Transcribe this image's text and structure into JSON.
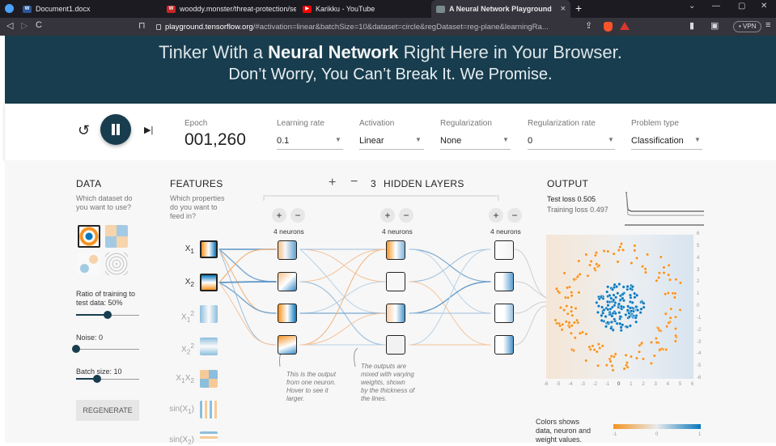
{
  "browser": {
    "tabs": [
      {
        "title": "Document1.docx",
        "icon": "word-icon",
        "color": "#2b579a"
      },
      {
        "title": "wooddy.monster/threat-protection/se",
        "icon": "site-icon",
        "color": "#c62828"
      },
      {
        "title": "Karikku - YouTube",
        "icon": "youtube-icon",
        "color": "#ff0000"
      },
      {
        "title": "A Neural Network Playground",
        "icon": "tensorflow-icon",
        "color": "#7a8a8f"
      }
    ],
    "url_host": "playground.tensorflow.org",
    "url_path": "/#activation=linear&batchSize=10&dataset=circle&regDataset=reg-plane&learningRa...",
    "vpn": "• VPN"
  },
  "hero": {
    "title_pre": "Tinker With a ",
    "title_bold": "Neural Network",
    "title_post": " Right Here in Your Browser.",
    "subtitle": "Don’t Worry, You Can’t Break It. We Promise."
  },
  "controls": {
    "epoch_label": "Epoch",
    "epoch_value": "001,260",
    "learning_rate_label": "Learning rate",
    "learning_rate_value": "0.1",
    "activation_label": "Activation",
    "activation_value": "Linear",
    "regularization_label": "Regularization",
    "regularization_value": "None",
    "reg_rate_label": "Regularization rate",
    "reg_rate_value": "0",
    "problem_type_label": "Problem type",
    "problem_type_value": "Classification"
  },
  "data_panel": {
    "title": "DATA",
    "desc": [
      "Which dataset do",
      "you want to use?"
    ],
    "ratio_label": [
      "Ratio of training to",
      "test data:  50%"
    ],
    "ratio_value": 0.5,
    "noise_label": "Noise:  0",
    "noise_value": 0,
    "batch_label": "Batch size:  10",
    "batch_value": 0.33,
    "regenerate": "REGENERATE"
  },
  "features": {
    "title": "FEATURES",
    "desc": [
      "Which properties",
      "do you want to",
      "feed in?"
    ],
    "items": [
      {
        "base": "X",
        "sub": "1",
        "sup": "",
        "active": true
      },
      {
        "base": "X",
        "sub": "2",
        "sup": "",
        "active": true
      },
      {
        "base": "X",
        "sub": "1",
        "sup": "2",
        "active": false
      },
      {
        "base": "X",
        "sub": "2",
        "sup": "2",
        "active": false
      },
      {
        "base": "X",
        "sub": "1",
        "sup": "",
        "base2": "X",
        "sub2": "2",
        "active": false
      },
      {
        "base": "sin(X",
        "sub": "1",
        "sup": "",
        "tail": ")",
        "active": false
      },
      {
        "base": "sin(X",
        "sub": "2",
        "sup": "",
        "tail": ")",
        "active": false
      }
    ]
  },
  "network": {
    "hidden_count": "3",
    "hidden_label": "HIDDEN LAYERS",
    "layers": [
      "4 neurons",
      "4 neurons",
      "4 neurons"
    ],
    "note1": [
      "This is the output",
      "from one neuron.",
      "Hover to see it",
      "larger."
    ],
    "note2": [
      "The outputs are",
      "mixed with varying",
      "weights, shown",
      "by the thickness of",
      "the lines."
    ]
  },
  "output": {
    "title": "OUTPUT",
    "test_loss": "Test loss 0.505",
    "training_loss": "Training loss 0.497",
    "x_ticks": [
      "-6",
      "-5",
      "-4",
      "-3",
      "-2",
      "-1",
      "0",
      "1",
      "2",
      "3",
      "4",
      "5",
      "6"
    ],
    "y_ticks": [
      "6",
      "5",
      "4",
      "3",
      "2",
      "1",
      "0",
      "-1",
      "-2",
      "-3",
      "-4",
      "-5",
      "-6"
    ],
    "legend_text": [
      "Colors shows",
      "data, neuron and",
      "weight values."
    ],
    "legend_ticks": [
      "-1",
      "0",
      "1"
    ],
    "colors": {
      "orange": "#f59322",
      "blue": "#0877bd"
    }
  }
}
